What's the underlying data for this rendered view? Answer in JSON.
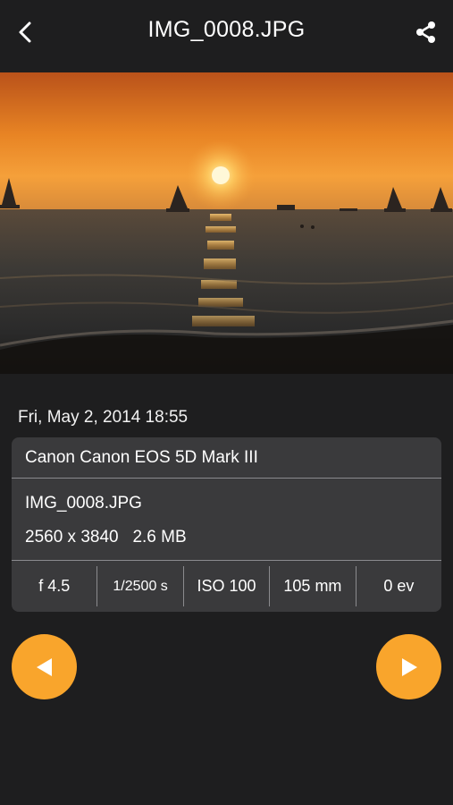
{
  "header": {
    "title": "IMG_0008.JPG",
    "back_icon": "chevron-left-icon",
    "share_icon": "share-icon"
  },
  "photo": {
    "description_icon": "sunset-photo"
  },
  "info": {
    "date": "Fri, May 2, 2014 18:55",
    "camera": "Canon Canon EOS 5D Mark III",
    "file_name": "IMG_0008.JPG",
    "dimensions": "2560 x 3840",
    "file_size": "2.6 MB",
    "exif": {
      "aperture": "f 4.5",
      "shutter": "1/2500 s",
      "iso": "ISO 100",
      "focal_length": "105 mm",
      "exposure": "0 ev"
    }
  },
  "nav": {
    "prev_icon": "play-left-icon",
    "next_icon": "play-right-icon"
  },
  "colors": {
    "background": "#1e1e1f",
    "card": "#3a3a3c",
    "accent": "#f9a52c",
    "divider": "#8a8a8e"
  }
}
